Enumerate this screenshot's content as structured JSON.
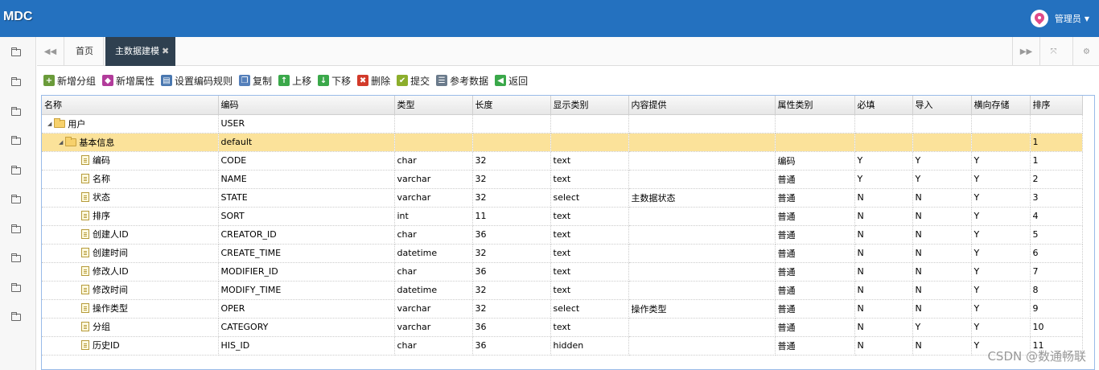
{
  "app": {
    "brand": "MDC",
    "user": "管理员"
  },
  "tabs": {
    "home": "首页",
    "active": "主数据建模",
    "close": "✖"
  },
  "toolbar": [
    {
      "label": "新增分组",
      "icon": "add-group-icon",
      "glyph": "+",
      "color": "#6a9b3a"
    },
    {
      "label": "新增属性",
      "icon": "add-attribute-icon",
      "glyph": "◆",
      "color": "#b23c9b"
    },
    {
      "label": "设置编码规则",
      "icon": "code-rule-icon",
      "glyph": "▤",
      "color": "#4a78b0"
    },
    {
      "label": "复制",
      "icon": "copy-icon",
      "glyph": "❐",
      "color": "#5580bb"
    },
    {
      "label": "上移",
      "icon": "arrow-up-icon",
      "glyph": "↑",
      "color": "#3aa84a"
    },
    {
      "label": "下移",
      "icon": "arrow-down-icon",
      "glyph": "↓",
      "color": "#3aa84a"
    },
    {
      "label": "删除",
      "icon": "delete-icon",
      "glyph": "✖",
      "color": "#d23a2a"
    },
    {
      "label": "提交",
      "icon": "submit-icon",
      "glyph": "✔",
      "color": "#8cae2c"
    },
    {
      "label": "参考数据",
      "icon": "reference-data-icon",
      "glyph": "☰",
      "color": "#6b7b8c"
    },
    {
      "label": "返回",
      "icon": "back-icon",
      "glyph": "◀",
      "color": "#3aa84a"
    }
  ],
  "columns": [
    "名称",
    "编码",
    "类型",
    "长度",
    "显示类别",
    "内容提供",
    "属性类别",
    "必填",
    "导入",
    "横向存储",
    "排序"
  ],
  "rows": [
    {
      "level": 0,
      "kind": "folder",
      "name": "用户",
      "code": "USER",
      "type": "",
      "length": "",
      "display": "",
      "provider": "",
      "category": "",
      "required": "",
      "import": "",
      "horizontal": "",
      "sort": ""
    },
    {
      "level": 1,
      "kind": "folder",
      "name": "基本信息",
      "code": "default",
      "type": "",
      "length": "",
      "display": "",
      "provider": "",
      "category": "",
      "required": "",
      "import": "",
      "horizontal": "",
      "sort": "1",
      "selected": true
    },
    {
      "level": 2,
      "kind": "file",
      "name": "编码",
      "code": "CODE",
      "type": "char",
      "length": "32",
      "display": "text",
      "provider": "",
      "category": "编码",
      "required": "Y",
      "import": "Y",
      "horizontal": "Y",
      "sort": "1"
    },
    {
      "level": 2,
      "kind": "file",
      "name": "名称",
      "code": "NAME",
      "type": "varchar",
      "length": "32",
      "display": "text",
      "provider": "",
      "category": "普通",
      "required": "Y",
      "import": "Y",
      "horizontal": "Y",
      "sort": "2"
    },
    {
      "level": 2,
      "kind": "file",
      "name": "状态",
      "code": "STATE",
      "type": "varchar",
      "length": "32",
      "display": "select",
      "provider": "主数据状态",
      "category": "普通",
      "required": "N",
      "import": "N",
      "horizontal": "Y",
      "sort": "3"
    },
    {
      "level": 2,
      "kind": "file",
      "name": "排序",
      "code": "SORT",
      "type": "int",
      "length": "11",
      "display": "text",
      "provider": "",
      "category": "普通",
      "required": "N",
      "import": "N",
      "horizontal": "Y",
      "sort": "4"
    },
    {
      "level": 2,
      "kind": "file",
      "name": "创建人ID",
      "code": "CREATOR_ID",
      "type": "char",
      "length": "36",
      "display": "text",
      "provider": "",
      "category": "普通",
      "required": "N",
      "import": "N",
      "horizontal": "Y",
      "sort": "5"
    },
    {
      "level": 2,
      "kind": "file",
      "name": "创建时间",
      "code": "CREATE_TIME",
      "type": "datetime",
      "length": "32",
      "display": "text",
      "provider": "",
      "category": "普通",
      "required": "N",
      "import": "N",
      "horizontal": "Y",
      "sort": "6"
    },
    {
      "level": 2,
      "kind": "file",
      "name": "修改人ID",
      "code": "MODIFIER_ID",
      "type": "char",
      "length": "36",
      "display": "text",
      "provider": "",
      "category": "普通",
      "required": "N",
      "import": "N",
      "horizontal": "Y",
      "sort": "7"
    },
    {
      "level": 2,
      "kind": "file",
      "name": "修改时间",
      "code": "MODIFY_TIME",
      "type": "datetime",
      "length": "32",
      "display": "text",
      "provider": "",
      "category": "普通",
      "required": "N",
      "import": "N",
      "horizontal": "Y",
      "sort": "8"
    },
    {
      "level": 2,
      "kind": "file",
      "name": "操作类型",
      "code": "OPER",
      "type": "varchar",
      "length": "32",
      "display": "select",
      "provider": "操作类型",
      "category": "普通",
      "required": "N",
      "import": "N",
      "horizontal": "Y",
      "sort": "9"
    },
    {
      "level": 2,
      "kind": "file",
      "name": "分组",
      "code": "CATEGORY",
      "type": "varchar",
      "length": "36",
      "display": "text",
      "provider": "",
      "category": "普通",
      "required": "N",
      "import": "Y",
      "horizontal": "Y",
      "sort": "10"
    },
    {
      "level": 2,
      "kind": "file",
      "name": "历史ID",
      "code": "HIS_ID",
      "type": "char",
      "length": "36",
      "display": "hidden",
      "provider": "",
      "category": "普通",
      "required": "N",
      "import": "N",
      "horizontal": "Y",
      "sort": "11"
    }
  ],
  "watermark": "CSDN @数通畅联"
}
